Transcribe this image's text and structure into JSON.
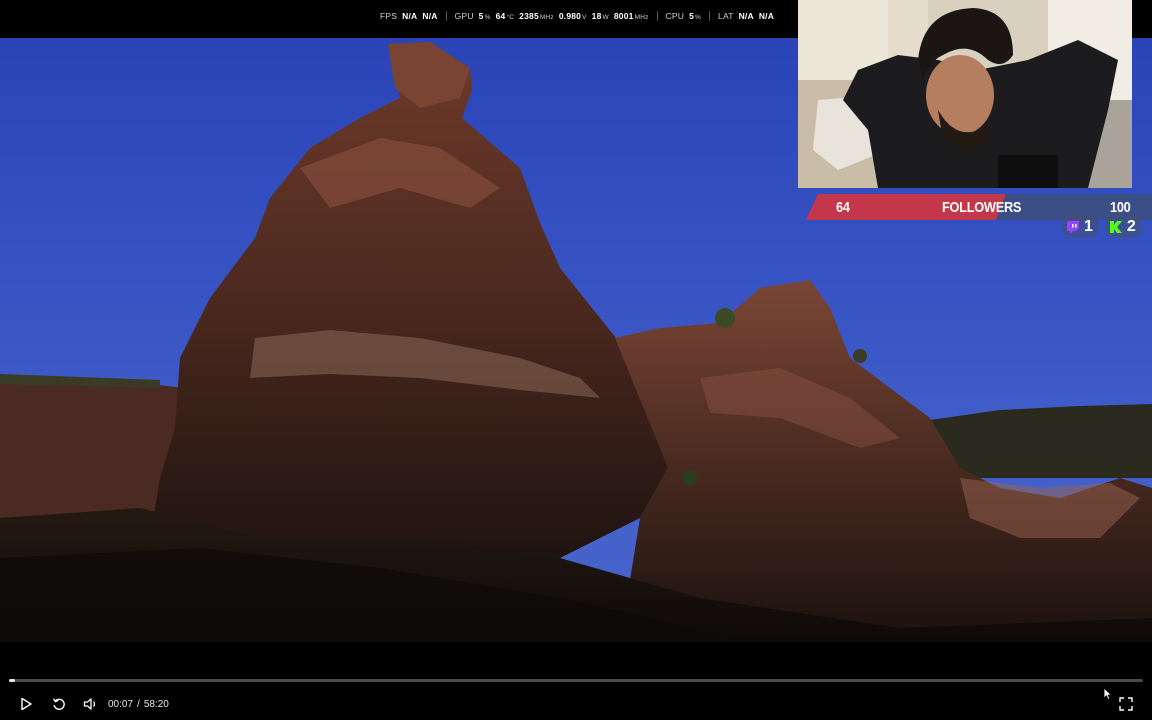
{
  "perf_overlay": {
    "fps": {
      "label": "FPS",
      "val1": "N/A",
      "val2": "N/A"
    },
    "gpu": {
      "label": "GPU",
      "usage": "5",
      "usage_unit": "%",
      "temp": "64",
      "temp_unit": "°C",
      "clock": "2385",
      "clock_unit": "MHz",
      "voltage": "0.980",
      "voltage_unit": "V",
      "power": "18",
      "power_unit": "W",
      "mem_clock": "8001",
      "mem_clock_unit": "MHz"
    },
    "cpu": {
      "label": "CPU",
      "usage": "5",
      "usage_unit": "%"
    },
    "lat": {
      "label": "LAT",
      "val1": "N/A",
      "val2": "N/A"
    }
  },
  "goal": {
    "current": "64",
    "label": "FOLLOWERS",
    "target": "100",
    "progress": 0.64,
    "left_color": "#c4364a",
    "right_color": "#3b4f86"
  },
  "subs": {
    "twitch_count": "1",
    "kick_count": "2",
    "twitch_color": "#9146ff",
    "kick_color": "#53fc18"
  },
  "player": {
    "current_time": "00:07",
    "separator": "/",
    "duration": "58:20",
    "progress": 0.002
  }
}
